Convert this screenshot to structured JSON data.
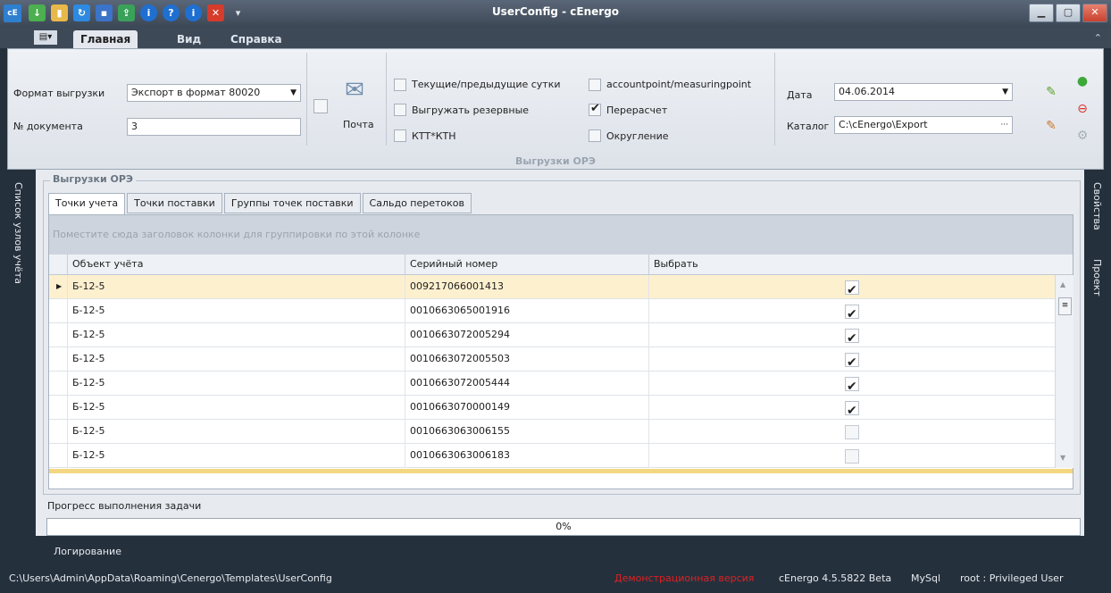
{
  "window": {
    "title": "UserConfig - cEnergo",
    "app_icon": "cE"
  },
  "quick_access": [
    "save-green-icon",
    "folder-icon",
    "refresh-icon",
    "disk-icon",
    "export-icon",
    "info-icon",
    "help-icon",
    "about-icon",
    "close-red-icon"
  ],
  "menu_tabs": {
    "main": "Главная",
    "view": "Вид",
    "help": "Справка"
  },
  "ribbon": {
    "format_label": "Формат выгрузки",
    "format_value": "Экспорт в формат 80020",
    "doc_label": "№ документа",
    "doc_value": "3",
    "mail_label": "Почта",
    "checkboxes": {
      "current_days": "Текущие/предыдущие сутки",
      "reserve": "Выгружать резервные",
      "ktt": "КТТ*КТН",
      "accountpoint": "accountpoint/measuringpoint",
      "recalc": "Перерасчет",
      "rounding": "Округление"
    },
    "checkbox_states": {
      "current_days": false,
      "reserve": false,
      "ktt": false,
      "accountpoint": false,
      "recalc": true,
      "rounding": false
    },
    "date_label": "Дата",
    "date_value": "04.06.2014",
    "catalog_label": "Каталог",
    "catalog_value": "C:\\cEnergo\\Export",
    "catalog_btn": "···",
    "group_label": "Выгрузки ОРЭ"
  },
  "left_panel": {
    "label": "Список узлов учёта"
  },
  "right_panel": {
    "properties": "Свойства",
    "project": "Проект"
  },
  "main": {
    "group_title": "Выгрузки ОРЭ",
    "tabs": [
      "Точки учета",
      "Точки поставки",
      "Группы точек поставки",
      "Сальдо перетоков"
    ],
    "group_hint": "Поместите сюда заголовок колонки для группировки по этой колонке",
    "columns": [
      "Объект учёта",
      "Серийный номер",
      "Выбрать"
    ],
    "rows": [
      {
        "object": "Б-12-5",
        "serial": "009217066001413",
        "selected": true
      },
      {
        "object": "Б-12-5",
        "serial": "0010663065001916",
        "selected": true
      },
      {
        "object": "Б-12-5",
        "serial": "0010663072005294",
        "selected": true
      },
      {
        "object": "Б-12-5",
        "serial": "0010663072005503",
        "selected": true
      },
      {
        "object": "Б-12-5",
        "serial": "0010663072005444",
        "selected": true
      },
      {
        "object": "Б-12-5",
        "serial": "0010663070000149",
        "selected": true
      },
      {
        "object": "Б-12-5",
        "serial": "0010663063006155",
        "selected": false
      },
      {
        "object": "Б-12-5",
        "serial": "0010663063006183",
        "selected": false
      }
    ],
    "progress_label": "Прогресс выполнения задачи",
    "progress_text": "0%",
    "progress_fraction": 0
  },
  "log_label": "Логирование",
  "status": {
    "path": "C:\\Users\\Admin\\AppData\\Roaming\\Cenergo\\Templates\\UserConfig",
    "demo": "Демонстрационная версия",
    "version": "cEnergo 4.5.5822 Beta",
    "db": "MySql",
    "user": "root : Privileged User"
  },
  "colors": {
    "accent": "#25303d",
    "selected_row": "#fdf0cf",
    "demo_text": "#e02020"
  }
}
